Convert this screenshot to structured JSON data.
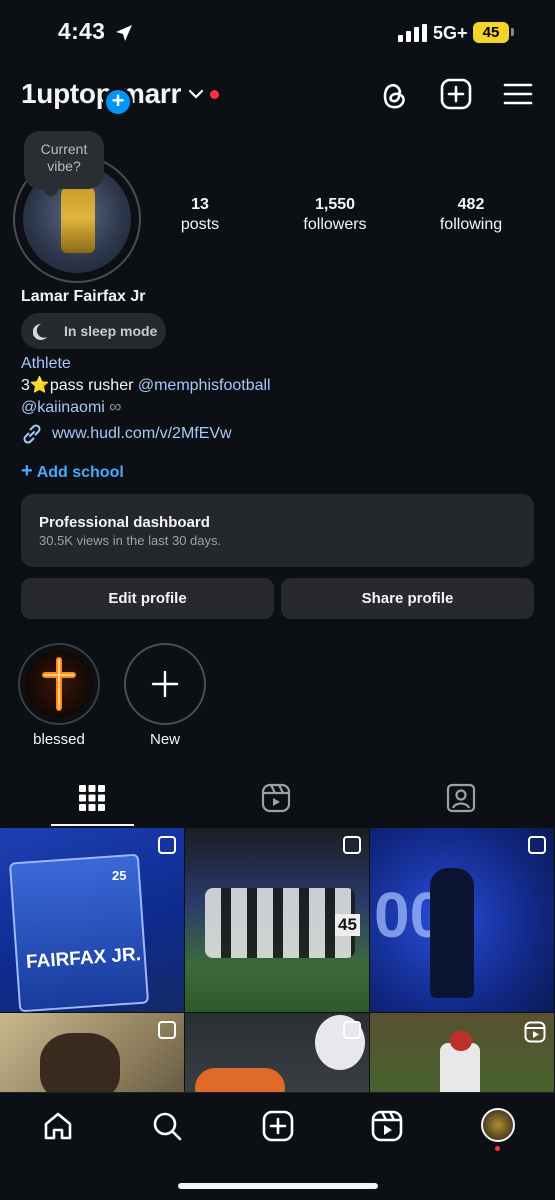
{
  "status_bar": {
    "time": "4:43",
    "network": "5G+",
    "battery": "45"
  },
  "header": {
    "username": "1uptop.marr"
  },
  "profile": {
    "vibe_prompt": "Current vibe?",
    "full_name": "Lamar Fairfax Jr",
    "sleep_mode": "In sleep mode",
    "category": "Athlete",
    "bio_line1_prefix": "3⭐️pass rusher ",
    "bio_line1_mention": "@memphisfootball",
    "bio_line2_mention": "@kaiinaomi",
    "bio_line2_symbol": "∞",
    "link": "www.hudl.com/v/2MfEVw",
    "add_school": "Add school"
  },
  "stats": [
    {
      "value": "13",
      "label": "posts"
    },
    {
      "value": "1,550",
      "label": "followers"
    },
    {
      "value": "482",
      "label": "following"
    }
  ],
  "dashboard": {
    "title": "Professional dashboard",
    "subtitle": "30.5K views in the last 30 days."
  },
  "actions": {
    "edit": "Edit profile",
    "share": "Share profile"
  },
  "highlights": [
    {
      "label": "blessed"
    },
    {
      "label": "New"
    }
  ],
  "grid_posts": [
    {
      "caption": "FAIRFAX JR.",
      "number": "25"
    },
    {
      "jersey": "45"
    },
    {
      "text": "00"
    }
  ],
  "colors": {
    "accent": "#0095f6",
    "link": "#a8c7fa",
    "background": "#0c1014",
    "notification": "#ff3040"
  }
}
